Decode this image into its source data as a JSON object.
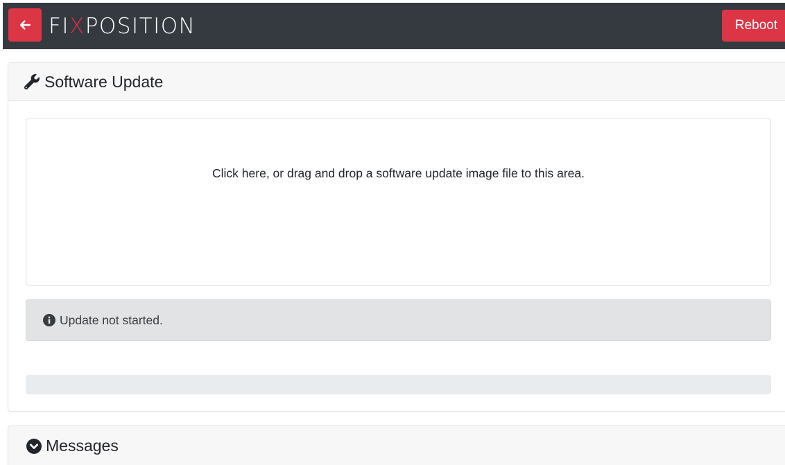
{
  "navbar": {
    "brand_prefix": "FI",
    "brand_x": "X",
    "brand_suffix": "POSITION",
    "back_icon": "arrow-left-icon",
    "reboot_label": "Reboot"
  },
  "update_card": {
    "title": "Software Update",
    "title_icon": "wrench-icon",
    "dropzone_text": "Click here, or drag and drop a software update image file to this area.",
    "status_icon": "info-circle-icon",
    "status_text": "Update not started.",
    "progress_fraction": 0
  },
  "messages_card": {
    "title": "Messages",
    "title_icon": "chevron-circle-down-icon"
  },
  "colors": {
    "navbar_bg": "#343a40",
    "accent_red": "#dc3545",
    "alert_bg": "#e2e3e5",
    "progress_track": "#e9ecef"
  }
}
